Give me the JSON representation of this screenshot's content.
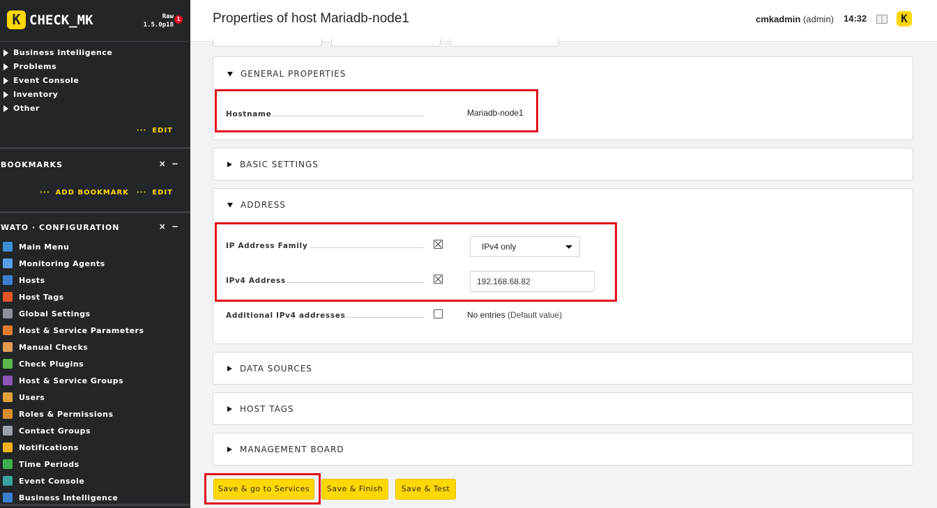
{
  "sidebar": {
    "logo_letter": "K",
    "logo_text": "CHECK_MK",
    "edition_line1": "Raw",
    "edition_line2": "1.5.0p18",
    "badge_count": "1",
    "views": [
      "Business Intelligence",
      "Problems",
      "Event Console",
      "Inventory",
      "Other"
    ],
    "edit_label": "EDIT",
    "bookmarks": {
      "title": "BOOKMARKS",
      "controls": "× −",
      "add_label": "ADD BOOKMARK",
      "edit_label": "EDIT"
    },
    "wato": {
      "title": "WATO · CONFIGURATION",
      "controls": "× −",
      "items": [
        {
          "label": "Main Menu",
          "icon": "home-icon",
          "color": "#3d8fd6"
        },
        {
          "label": "Monitoring Agents",
          "icon": "agents-icon",
          "color": "#5aa0e6"
        },
        {
          "label": "Hosts",
          "icon": "hosts-icon",
          "color": "#3b7fd0"
        },
        {
          "label": "Host Tags",
          "icon": "tag-icon",
          "color": "#e45528"
        },
        {
          "label": "Global Settings",
          "icon": "gear-icon",
          "color": "#8a9199"
        },
        {
          "label": "Host & Service Parameters",
          "icon": "rules-icon",
          "color": "#e07a2c"
        },
        {
          "label": "Manual Checks",
          "icon": "hand-icon",
          "color": "#e39b52"
        },
        {
          "label": "Check Plugins",
          "icon": "puzzle-icon",
          "color": "#5ab54a"
        },
        {
          "label": "Host & Service Groups",
          "icon": "groups-icon",
          "color": "#8e55b6"
        },
        {
          "label": "Users",
          "icon": "users-icon",
          "color": "#e0a03a"
        },
        {
          "label": "Roles & Permissions",
          "icon": "roles-icon",
          "color": "#d98f2e"
        },
        {
          "label": "Contact Groups",
          "icon": "contact-groups-icon",
          "color": "#9aa2aa"
        },
        {
          "label": "Notifications",
          "icon": "bell-icon",
          "color": "#f2b21a"
        },
        {
          "label": "Time Periods",
          "icon": "clock-icon",
          "color": "#3fae49"
        },
        {
          "label": "Event Console",
          "icon": "event-console-icon",
          "color": "#3aa3a0"
        },
        {
          "label": "Business Intelligence",
          "icon": "bi-icon",
          "color": "#3b7fd0"
        }
      ]
    }
  },
  "header": {
    "title": "Properties of host Mariadb-node1",
    "username": "cmkadmin",
    "role": "(admin)",
    "time": "14:32"
  },
  "sections": {
    "general": {
      "title": "GENERAL PROPERTIES",
      "hostname_label": "Hostname",
      "hostname_value": "Mariadb-node1"
    },
    "basic": {
      "title": "BASIC SETTINGS"
    },
    "address": {
      "title": "ADDRESS",
      "ip_family_label": "IP Address Family",
      "ip_family_value": "IPv4 only",
      "ipv4_label": "IPv4 Address",
      "ipv4_value": "192.168.68.82",
      "additional_label": "Additional IPv4 addresses",
      "additional_value": "No entries",
      "additional_default": "(Default value)"
    },
    "data_sources": {
      "title": "DATA SOURCES"
    },
    "host_tags": {
      "title": "HOST TAGS"
    },
    "management_board": {
      "title": "MANAGEMENT BOARD"
    }
  },
  "buttons": {
    "save_services": "Save & go to Services",
    "save_finish": "Save & Finish",
    "save_test": "Save & Test"
  }
}
